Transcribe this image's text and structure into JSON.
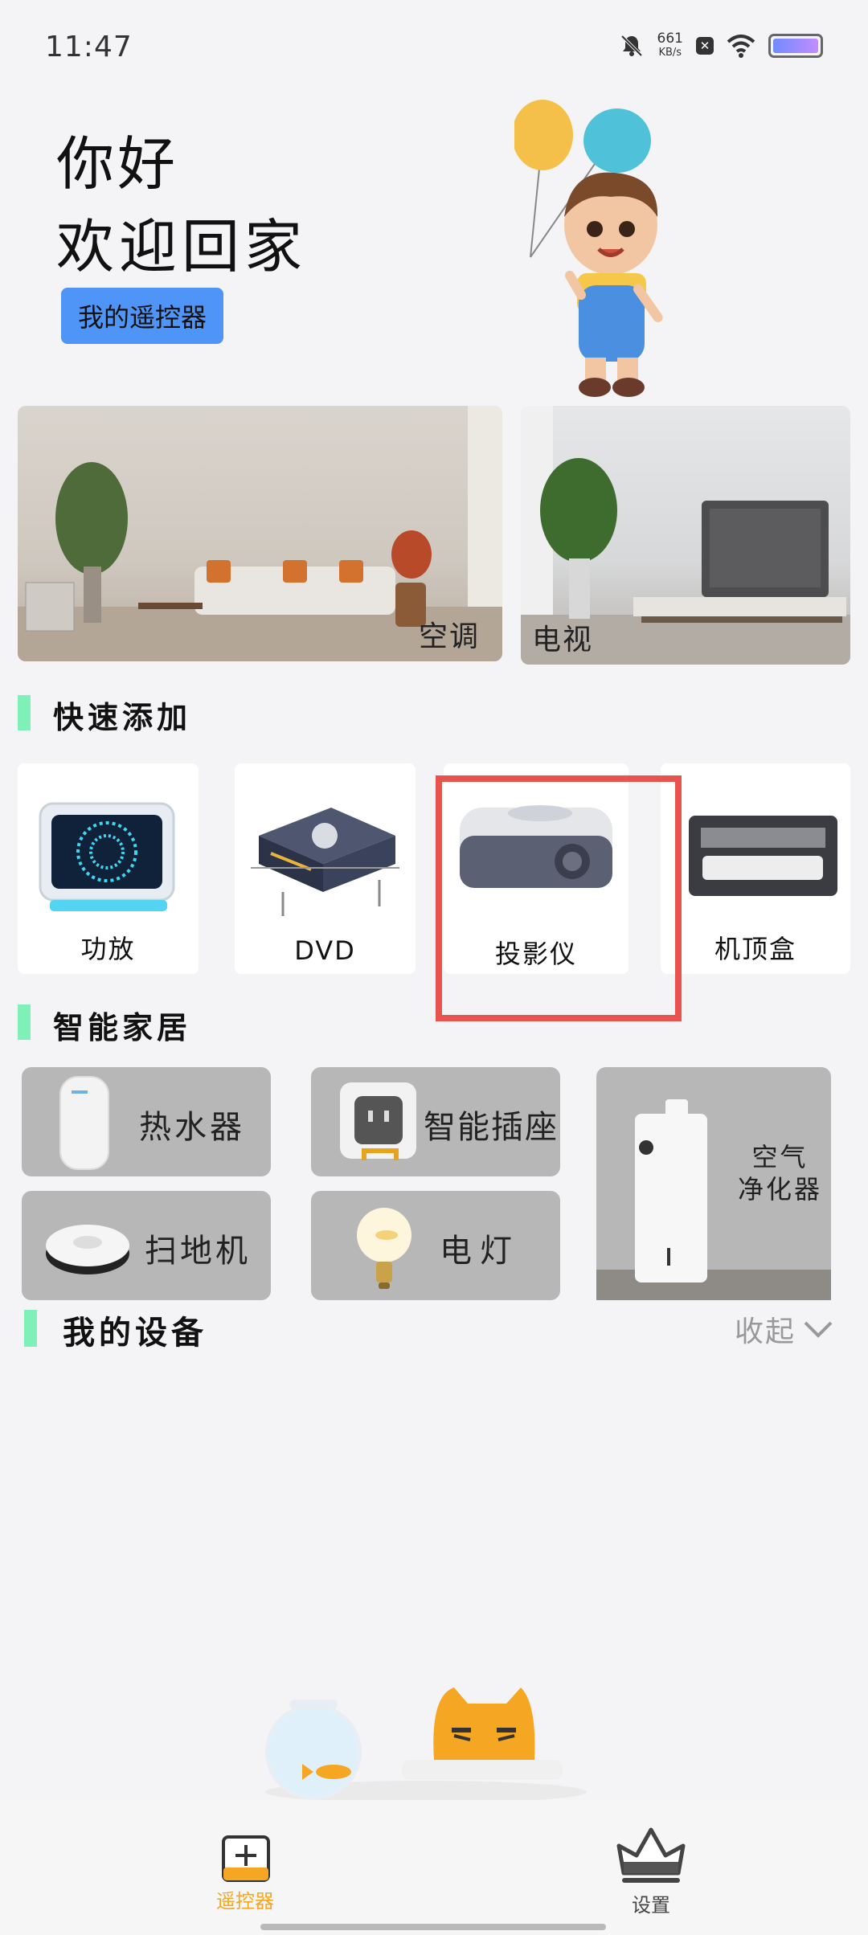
{
  "status": {
    "time": "11:47",
    "speed_value": "661",
    "speed_unit": "KB/s"
  },
  "hero": {
    "greeting": "你好",
    "welcome": "欢迎回家",
    "my_remote_button": "我的遥控器"
  },
  "rooms": [
    {
      "label": "空调"
    },
    {
      "label": "电视"
    }
  ],
  "quick_add": {
    "title": "快速添加",
    "items": [
      {
        "label": "功放"
      },
      {
        "label": "DVD"
      },
      {
        "label": "投影仪"
      },
      {
        "label": "机顶盒"
      }
    ]
  },
  "smart_home": {
    "title": "智能家居",
    "items": [
      {
        "label": "热水器"
      },
      {
        "label": "智能插座"
      },
      {
        "label": "扫地机"
      },
      {
        "label": "电灯"
      },
      {
        "label_line1": "空气",
        "label_line2": "净化器"
      }
    ]
  },
  "my_devices": {
    "title": "我的设备",
    "collapse_label": "收起"
  },
  "bottom_nav": {
    "items": [
      {
        "label": "遥控器",
        "active": true
      },
      {
        "label": "设置",
        "active": false
      }
    ]
  },
  "colors": {
    "accent": "#f5a623",
    "button_blue": "#4f95f7",
    "section_bar": "#7ef0b8",
    "highlight_red": "#e8534e"
  }
}
